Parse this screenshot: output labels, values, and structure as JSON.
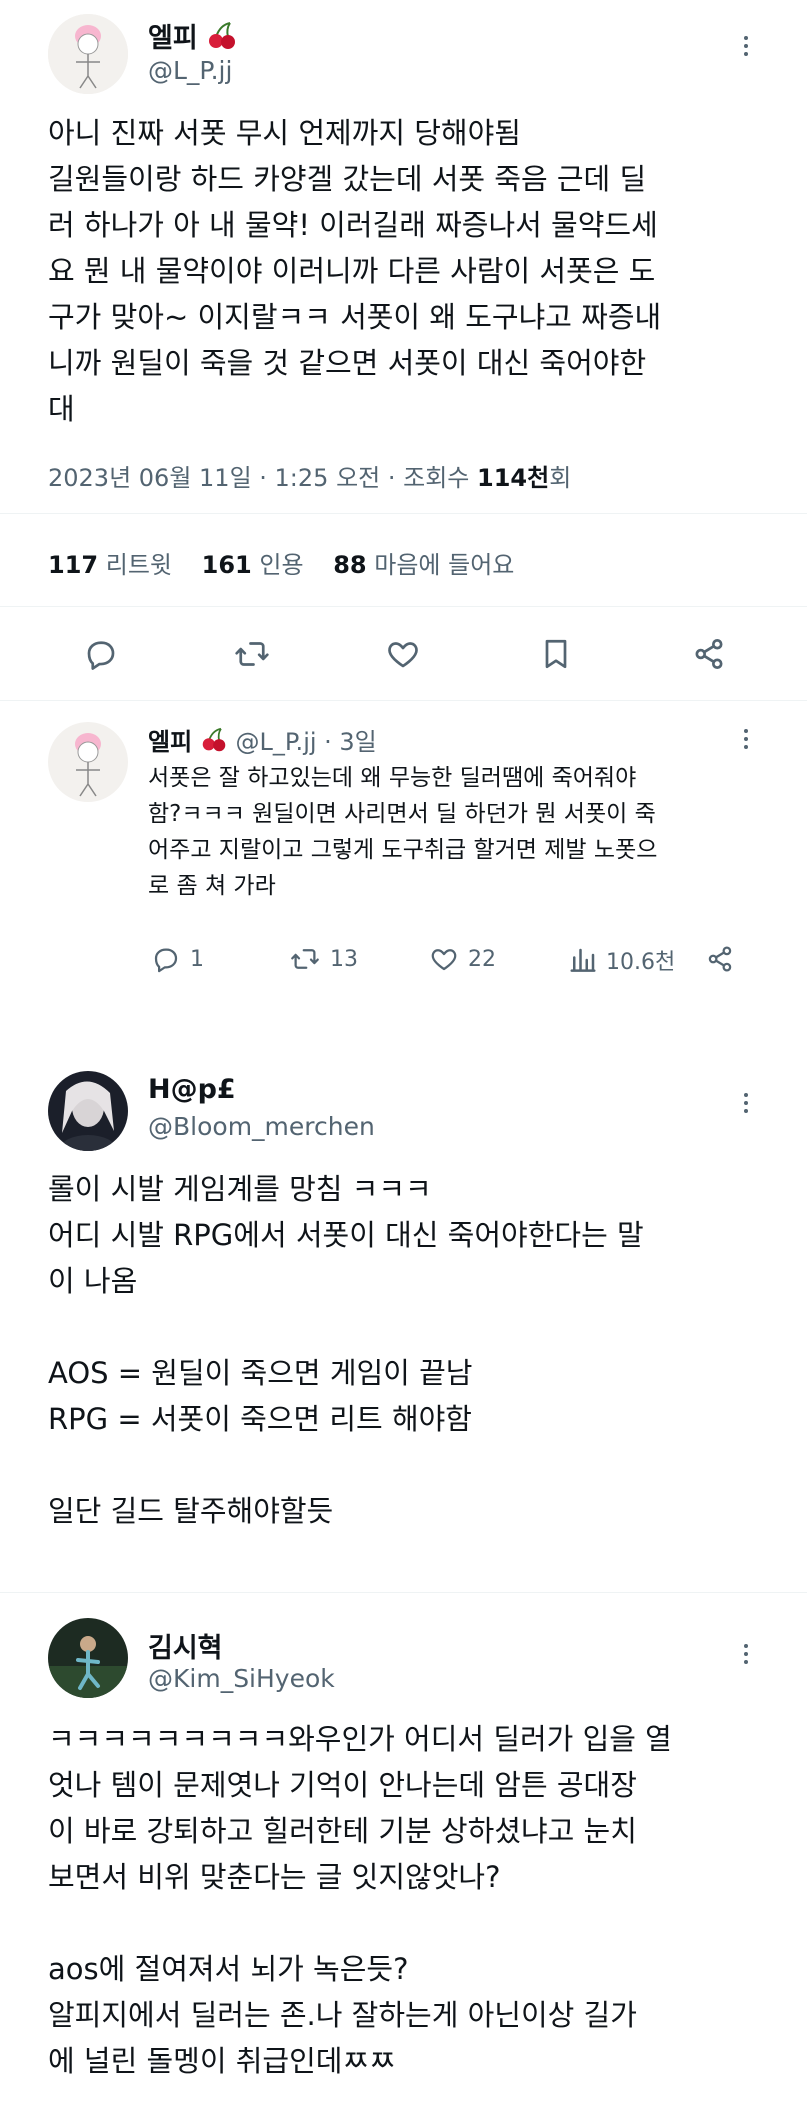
{
  "main_tweet": {
    "display_name": "엘피",
    "handle": "@L_P.jj",
    "lines": [
      "아니 진짜 서폿 무시 언제까지 당해야됨",
      "길원들이랑 하드 카양겔 갔는데 서폿 죽음 근데 딜",
      "러 하나가 아 내 물약! 이러길래 짜증나서 물약드세",
      "요 뭔 내 물약이야 이러니까 다른 사람이 서폿은 도",
      "구가 맞아~ 이지랄ㅋㅋ 서폿이 왜 도구냐고 짜증내",
      "니까 원딜이 죽을 것 같으면 서폿이 대신 죽어야한",
      "대"
    ],
    "timestamp": "2023년 06월 11일 · 1:25 오전 · 조회수",
    "views_count": "114천",
    "views_suffix": "회",
    "stats": {
      "retweets_count": "117",
      "retweets_label": "리트윗",
      "quotes_count": "161",
      "quotes_label": "인용",
      "likes_count": "88",
      "likes_label": "마음에 들어요"
    }
  },
  "reply": {
    "display_name": "엘피",
    "handle_time": "@L_P.jj · 3일",
    "lines": [
      "서폿은 잘 하고있는데 왜 무능한 딜러땜에 죽어줘야",
      "함?ㅋㅋㅋ 원딜이면 사리면서 딜 하던가 뭔 서폿이 죽",
      "어주고 지랄이고 그렇게 도구취급 할거면 제발 노폿으",
      "로 좀 쳐 가라"
    ],
    "replies": "1",
    "retweets": "13",
    "likes": "22",
    "views": "10.6천"
  },
  "post2": {
    "display_name": "H@p£",
    "handle": "@Bloom_merchen",
    "lines": [
      "롤이 시발 게임계를 망침 ㅋㅋㅋ",
      "어디 시발 RPG에서 서폿이 대신 죽어야한다는 말",
      "이 나옴",
      "",
      "AOS = 원딜이 죽으면 게임이 끝남",
      "RPG = 서폿이 죽으면 리트 해야함",
      "",
      "일단 길드 탈주해야할듯"
    ]
  },
  "post3": {
    "display_name": "김시혁",
    "handle": "@Kim_SiHyeok",
    "lines": [
      "ㅋㅋㅋㅋㅋㅋㅋㅋㅋ와우인가 어디서 딜러가 입을 열",
      "엇나 템이 문제엿나 기억이 안나는데 암튼 공대장",
      "이 바로 강퇴하고 힐러한테 기분 상하셨냐고 눈치",
      "보면서 비위 맞춘다는 글 잇지않앗나?",
      "",
      "aos에 절여져서 뇌가 녹은듯?",
      "알피지에서 딜러는 존.나 잘하는게 아닌이상 길가",
      "에 널린 돌멩이 취급인데ㅉㅉ"
    ]
  },
  "colors": {
    "text": "#0f1419",
    "muted": "#536471",
    "divider": "#eff3f4"
  },
  "icons": [
    "cherry-icon",
    "more-icon",
    "reply-icon",
    "retweet-icon",
    "like-icon",
    "bookmark-icon",
    "share-icon",
    "views-icon"
  ]
}
